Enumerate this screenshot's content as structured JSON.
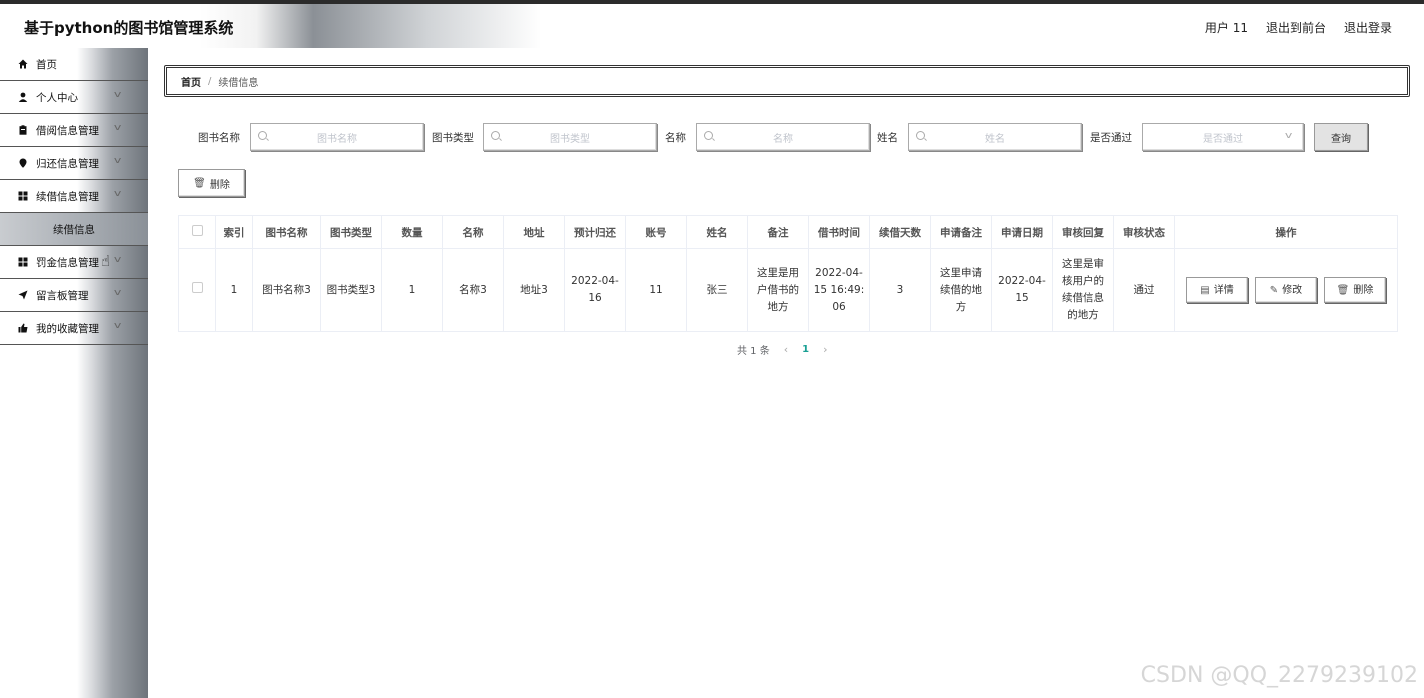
{
  "header": {
    "title": "基于python的图书馆管理系统",
    "user": "用户 11",
    "front": "退出到前台",
    "logout": "退出登录"
  },
  "sidebar": {
    "items": [
      {
        "label": "首页",
        "icon": "home-icon"
      },
      {
        "label": "个人中心",
        "icon": "user-icon"
      },
      {
        "label": "借阅信息管理",
        "icon": "clipboard-icon"
      },
      {
        "label": "归还信息管理",
        "icon": "location-icon"
      },
      {
        "label": "续借信息管理",
        "icon": "grid-icon"
      },
      {
        "label": "罚金信息管理",
        "icon": "grid-icon"
      },
      {
        "label": "留言板管理",
        "icon": "send-icon"
      },
      {
        "label": "我的收藏管理",
        "icon": "thumb-icon"
      }
    ],
    "subitem": "续借信息"
  },
  "breadcrumb": {
    "home": "首页",
    "sep": "/",
    "current": "续借信息"
  },
  "filters": {
    "book_name": {
      "label": "图书名称",
      "placeholder": "图书名称"
    },
    "book_type": {
      "label": "图书类型",
      "placeholder": "图书类型"
    },
    "name": {
      "label": "名称",
      "placeholder": "名称"
    },
    "person": {
      "label": "姓名",
      "placeholder": "姓名"
    },
    "pass": {
      "label": "是否通过",
      "placeholder": "是否通过"
    },
    "query": "查询"
  },
  "delete_button": "删除",
  "table": {
    "headers": [
      "索引",
      "图书名称",
      "图书类型",
      "数量",
      "名称",
      "地址",
      "预计归还",
      "账号",
      "姓名",
      "备注",
      "借书时间",
      "续借天数",
      "申请备注",
      "申请日期",
      "审核回复",
      "审核状态",
      "操作"
    ],
    "rows": [
      [
        "1",
        "图书名称3",
        "图书类型3",
        "1",
        "名称3",
        "地址3",
        "2022-04-16",
        "11",
        "张三",
        "这里是用户借书的地方",
        "2022-04-15 16:49:06",
        "3",
        "这里申请续借的地方",
        "2022-04-15",
        "这里是审核用户的续借信息的地方",
        "通过"
      ]
    ],
    "actions": {
      "detail": "详情",
      "edit": "修改",
      "delete": "删除"
    }
  },
  "pager": {
    "total": "共 1 条",
    "page": "1"
  },
  "watermark": "CSDN @QQ_2279239102"
}
